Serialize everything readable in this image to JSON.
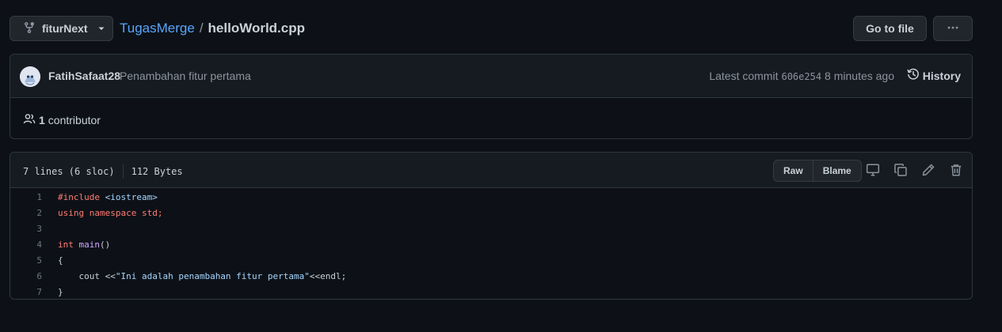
{
  "branch": {
    "name": "fiturNext"
  },
  "breadcrumb": {
    "repo": "TugasMerge",
    "separator": "/",
    "file": "helloWorld.cpp"
  },
  "actions": {
    "go_to_file": "Go to file",
    "more": "···"
  },
  "commit": {
    "author": "FatihSafaat28",
    "message": "Penambahan fitur pertama",
    "latest_label": "Latest commit",
    "sha": "606e254",
    "time": "8 minutes ago",
    "history_label": "History"
  },
  "contributors": {
    "count": "1",
    "label": "contributor"
  },
  "file": {
    "lines_info": "7 lines (6 sloc)",
    "size": "112 Bytes",
    "raw_label": "Raw",
    "blame_label": "Blame"
  },
  "code_lines": [
    {
      "n": "1",
      "text": "#include <iostream>"
    },
    {
      "n": "2",
      "text": "using namespace std;"
    },
    {
      "n": "3",
      "text": ""
    },
    {
      "n": "4",
      "text": "int main()"
    },
    {
      "n": "5",
      "text": "{"
    },
    {
      "n": "6",
      "text": "    cout <<\"Ini adalah penambahan fitur pertama\"<<endl;"
    },
    {
      "n": "7",
      "text": "}"
    }
  ],
  "icons": {
    "branch": "git-branch-icon",
    "caret": "chevron-down-icon",
    "kebab": "kebab-horizontal-icon",
    "history": "history-clock-icon",
    "people": "people-icon",
    "desktop": "desktop-icon",
    "copy": "copy-icon",
    "edit": "pencil-icon",
    "delete": "trash-icon"
  },
  "colors": {
    "background": "#0d1117",
    "panel": "#161b22",
    "border": "#30363d",
    "link": "#58a6ff",
    "keyword": "#ff7b72",
    "entity": "#d2a8ff",
    "string": "#a5d6ff"
  }
}
